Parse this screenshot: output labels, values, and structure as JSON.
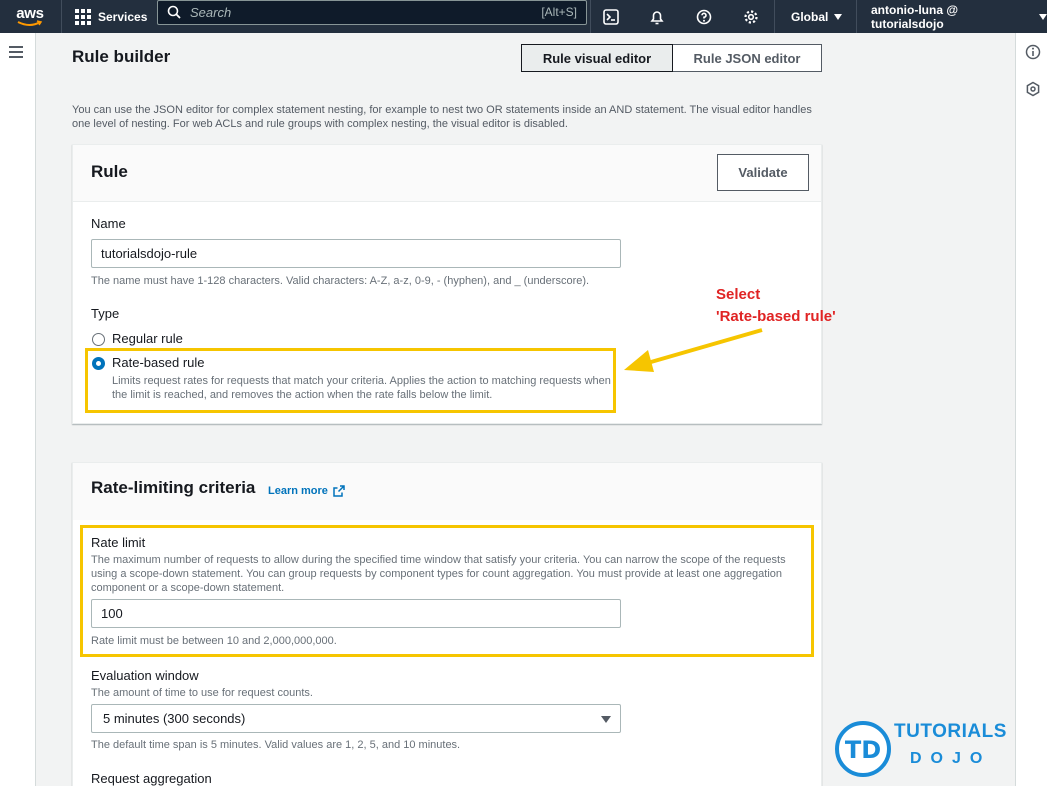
{
  "topbar": {
    "logo_text": "aws",
    "services_label": "Services",
    "search_placeholder": "Search",
    "search_shortcut": "[Alt+S]",
    "region_label": "Global",
    "user_label": "antonio-luna @ tutorialsdojo",
    "bg_color": "#232f3e"
  },
  "page": {
    "title": "Rule builder",
    "tabs": [
      {
        "label": "Rule visual editor",
        "active": true
      },
      {
        "label": "Rule JSON editor",
        "active": false
      }
    ],
    "description": "You can use the JSON editor for complex statement nesting, for example to nest two OR statements inside an AND statement. The visual editor handles one level of nesting. For web ACLs and rule groups with complex nesting, the visual editor is disabled."
  },
  "rule_panel": {
    "title": "Rule",
    "validate_label": "Validate",
    "name_label": "Name",
    "name_value": "tutorialsdojo-rule",
    "name_hint": "The name must have 1-128 characters. Valid characters: A-Z, a-z, 0-9, - (hyphen), and _ (underscore).",
    "type_label": "Type",
    "type_options": [
      {
        "label": "Regular rule",
        "selected": false
      },
      {
        "label": "Rate-based rule",
        "selected": true,
        "description": "Limits request rates for requests that match your criteria. Applies the action to matching requests when the limit is reached, and removes the action when the rate falls below the limit."
      }
    ]
  },
  "rate_panel": {
    "title": "Rate-limiting criteria",
    "learn_more": "Learn more",
    "rate_limit_label": "Rate limit",
    "rate_limit_desc": "The maximum number of requests to allow during the specified time window that satisfy your criteria. You can narrow the scope of the requests using a scope-down statement. You can group requests by component types for count aggregation. You must provide at least one aggregation component or a scope-down statement.",
    "rate_limit_value": "100",
    "rate_limit_hint": "Rate limit must be between 10 and 2,000,000,000.",
    "eval_window_label": "Evaluation window",
    "eval_window_desc": "The amount of time to use for request counts.",
    "eval_window_value": "5 minutes (300 seconds)",
    "eval_window_hint": "The default time span is 5 minutes. Valid values are 1, 2, 5, and 10 minutes.",
    "aggregation_label": "Request aggregation"
  },
  "annotation": {
    "line1": "Select",
    "line2": "'Rate-based rule'",
    "highlight_color": "#f6c500",
    "text_color": "#e02424"
  },
  "watermark": {
    "line1": "TUTORIALS",
    "line2": "DOJO",
    "badge": "TD"
  }
}
